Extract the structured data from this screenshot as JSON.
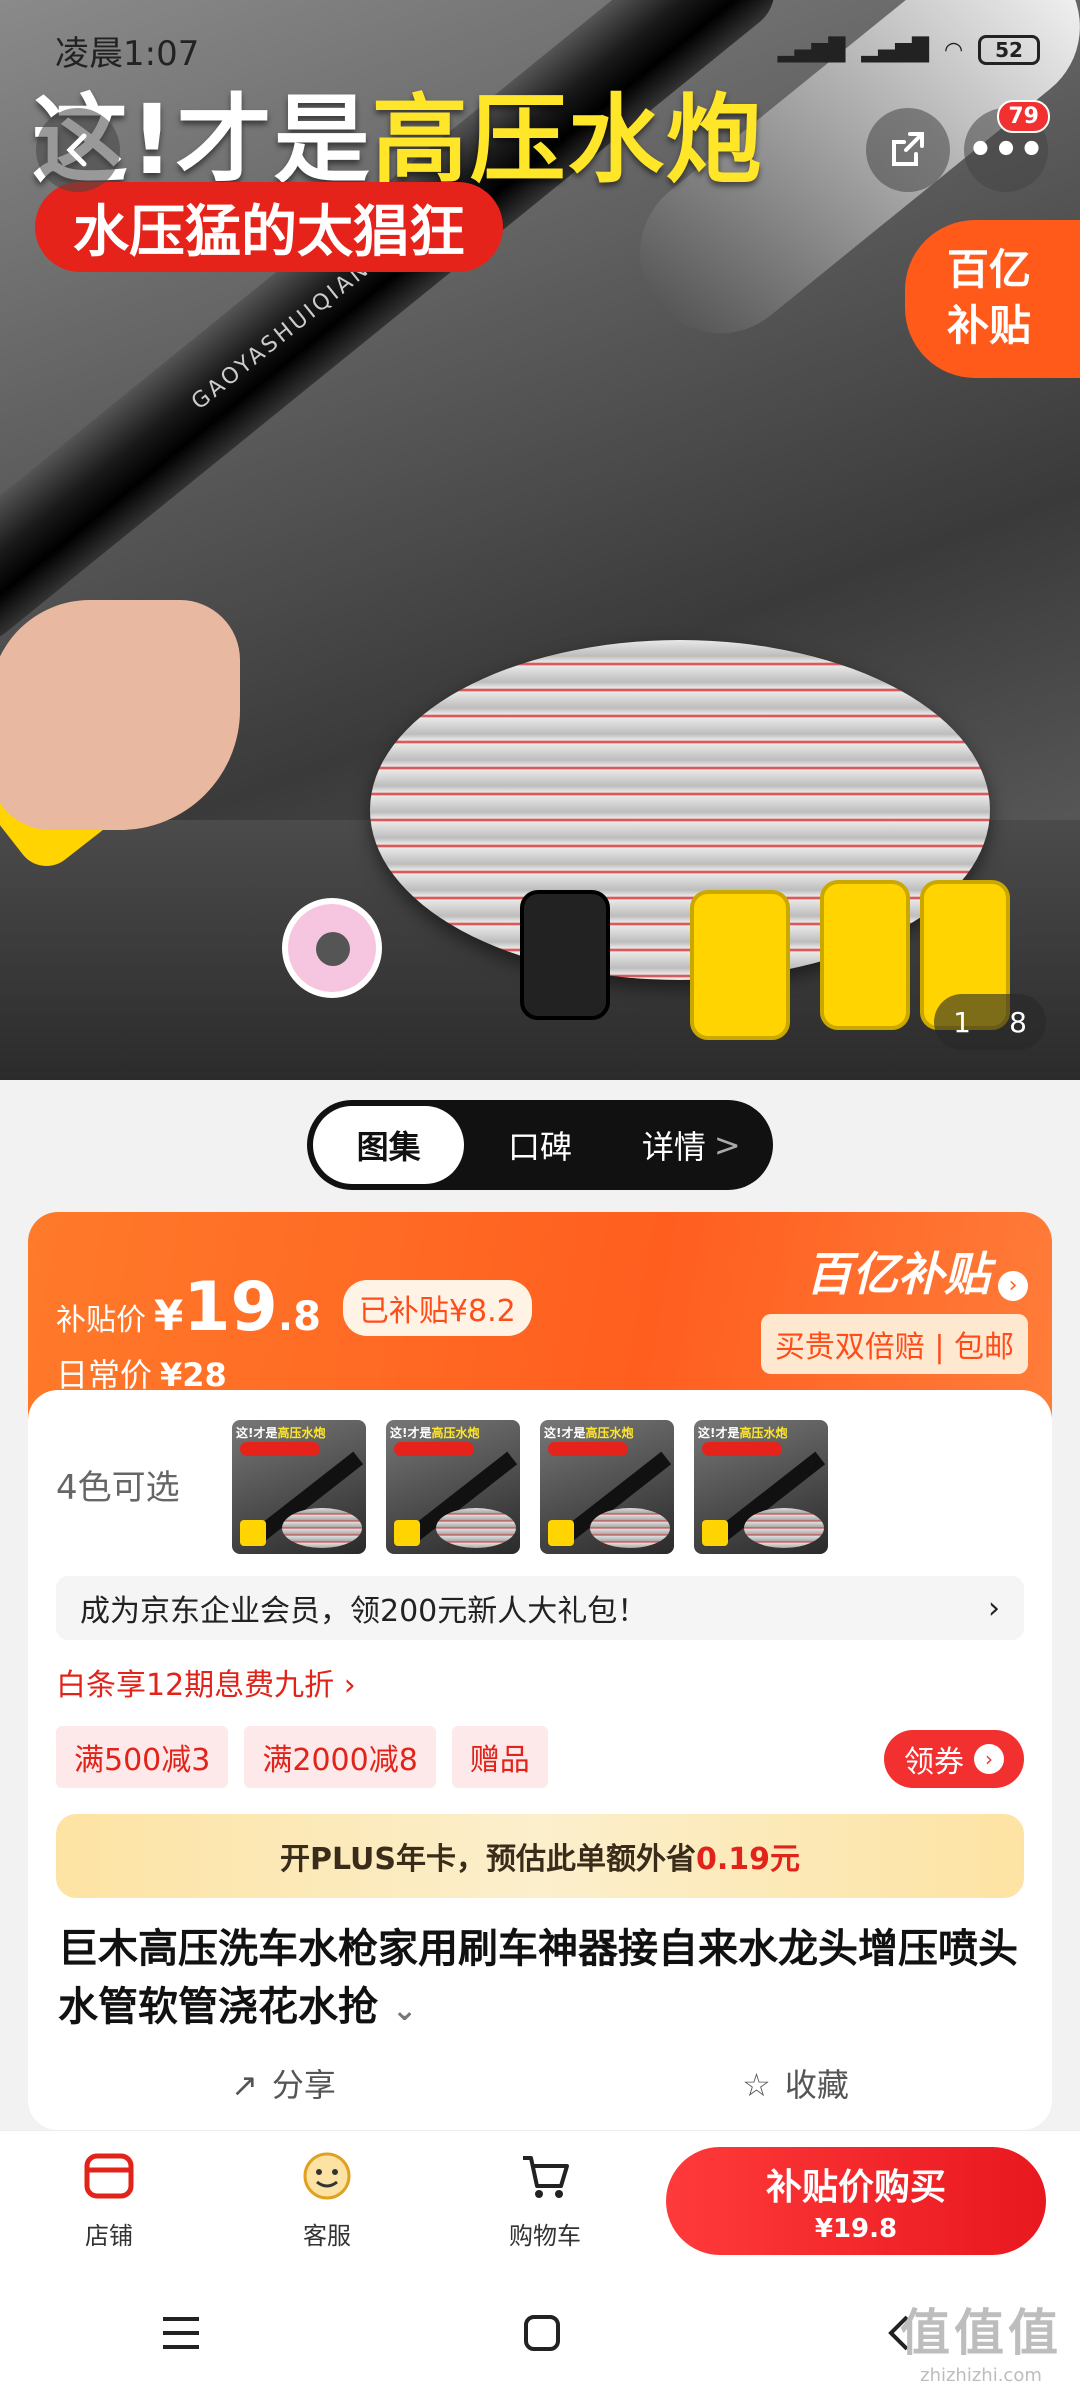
{
  "status": {
    "time": "凌晨1:07",
    "battery": "52"
  },
  "hero": {
    "headline_white": "这!才是",
    "headline_yellow": "高压水炮",
    "subline": "水压猛的太猖狂",
    "gun_text": "GAOYASHUIQIANG",
    "subsidy_tag_line1": "百亿",
    "subsidy_tag_line2": "补贴",
    "more_badge": "79",
    "pager_current": "1",
    "pager_total": "8"
  },
  "tabs": [
    {
      "label": "图集"
    },
    {
      "label": "口碑"
    },
    {
      "label": "详情"
    }
  ],
  "price": {
    "label": "补贴价",
    "currency": "¥",
    "integer": "19",
    "decimal": ".8",
    "subsidized": "已补贴¥8.2",
    "daily_label": "日常价",
    "daily_value": "¥28",
    "brand": "百亿补贴",
    "brand_sub": "买贵双倍赔 | 包邮"
  },
  "variants": {
    "label": "4色可选",
    "thumb_title_white": "这!才是",
    "thumb_title_yellow": "高压水炮",
    "thumb_sub": "水压猛的太猖狂"
  },
  "member_banner": "成为京东企业会员，领200元新人大礼包！",
  "baitiao": "白条享12期息费九折 ›",
  "coupons": [
    "满500减3",
    "满2000减8",
    "赠品"
  ],
  "get_coupon": "领券",
  "plus": {
    "text_before": "开PLUS年卡，预估此单额外省",
    "amount": "0.19元"
  },
  "product_title": "巨木高压洗车水枪家用刷车神器接自来水龙头增压喷头水管软管浇花水抢",
  "actions": {
    "share": "分享",
    "favorite": "收藏"
  },
  "bottom": {
    "store": "店铺",
    "service": "客服",
    "cart": "购物车",
    "buy_label": "补贴价购买",
    "buy_price": "¥19.8"
  },
  "watermark": {
    "line1": "值值值",
    "line2": "zhizhizhi.com"
  },
  "colors": {
    "accent": "#ff5e1f",
    "red": "#e2231a",
    "yellow": "#ffe629"
  }
}
